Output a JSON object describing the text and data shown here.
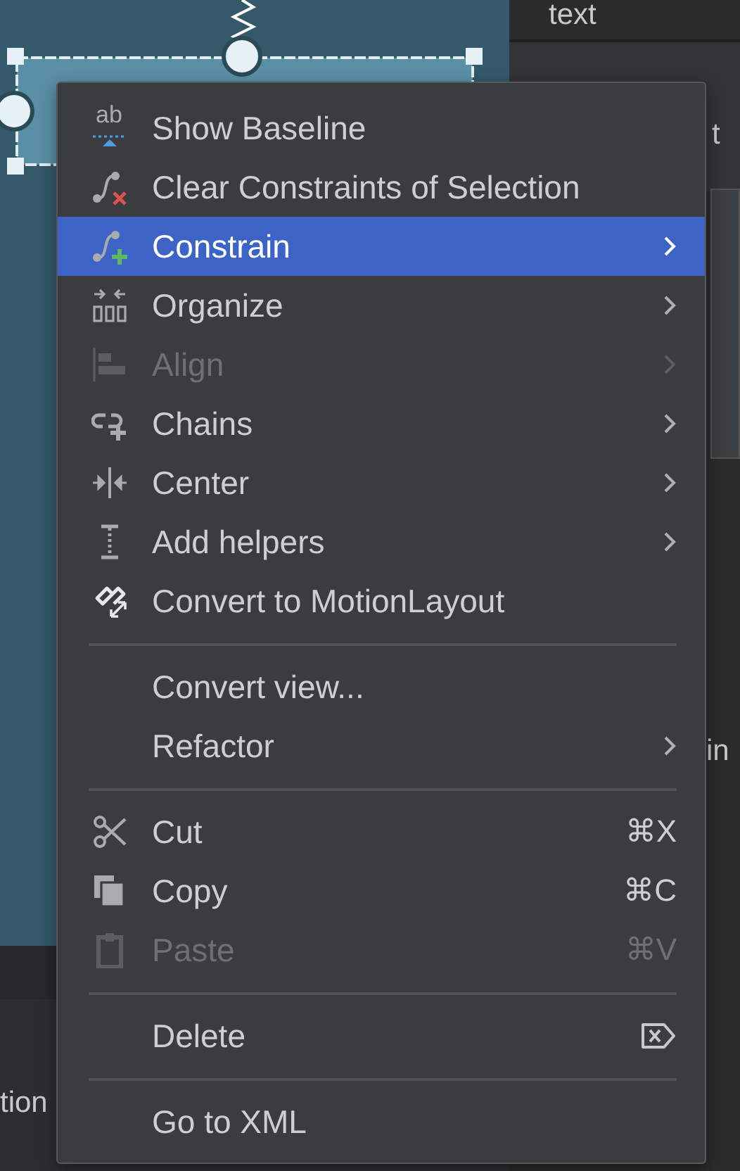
{
  "background": {
    "panel_header": "text",
    "panel_fragment": "t",
    "panel_fragment_2": "in",
    "bottom_fragment": "tion"
  },
  "context_menu": {
    "items": [
      {
        "kind": "item",
        "label": "Show Baseline",
        "icon_label": "ab",
        "selected": false,
        "disabled": false,
        "submenu": false
      },
      {
        "kind": "item",
        "label": "Clear Constraints of Selection",
        "selected": false,
        "disabled": false,
        "submenu": false
      },
      {
        "kind": "item",
        "label": "Constrain",
        "selected": true,
        "disabled": false,
        "submenu": true
      },
      {
        "kind": "item",
        "label": "Organize",
        "selected": false,
        "disabled": false,
        "submenu": true
      },
      {
        "kind": "item",
        "label": "Align",
        "selected": false,
        "disabled": true,
        "submenu": true
      },
      {
        "kind": "item",
        "label": "Chains",
        "selected": false,
        "disabled": false,
        "submenu": true
      },
      {
        "kind": "item",
        "label": "Center",
        "selected": false,
        "disabled": false,
        "submenu": true
      },
      {
        "kind": "item",
        "label": "Add helpers",
        "selected": false,
        "disabled": false,
        "submenu": true
      },
      {
        "kind": "item",
        "label": "Convert to MotionLayout",
        "selected": false,
        "disabled": false,
        "submenu": false
      },
      {
        "kind": "separator"
      },
      {
        "kind": "item",
        "label": "Convert view...",
        "selected": false,
        "disabled": false,
        "submenu": false
      },
      {
        "kind": "item",
        "label": "Refactor",
        "selected": false,
        "disabled": false,
        "submenu": true
      },
      {
        "kind": "separator"
      },
      {
        "kind": "item",
        "label": "Cut",
        "shortcut": "⌘X",
        "selected": false,
        "disabled": false,
        "submenu": false
      },
      {
        "kind": "item",
        "label": "Copy",
        "shortcut": "⌘C",
        "selected": false,
        "disabled": false,
        "submenu": false
      },
      {
        "kind": "item",
        "label": "Paste",
        "shortcut": "⌘V",
        "selected": false,
        "disabled": true,
        "submenu": false
      },
      {
        "kind": "separator"
      },
      {
        "kind": "item",
        "label": "Delete",
        "selected": false,
        "disabled": false,
        "submenu": false
      },
      {
        "kind": "separator"
      },
      {
        "kind": "item",
        "label": "Go to XML",
        "selected": false,
        "disabled": false,
        "submenu": false
      }
    ]
  }
}
